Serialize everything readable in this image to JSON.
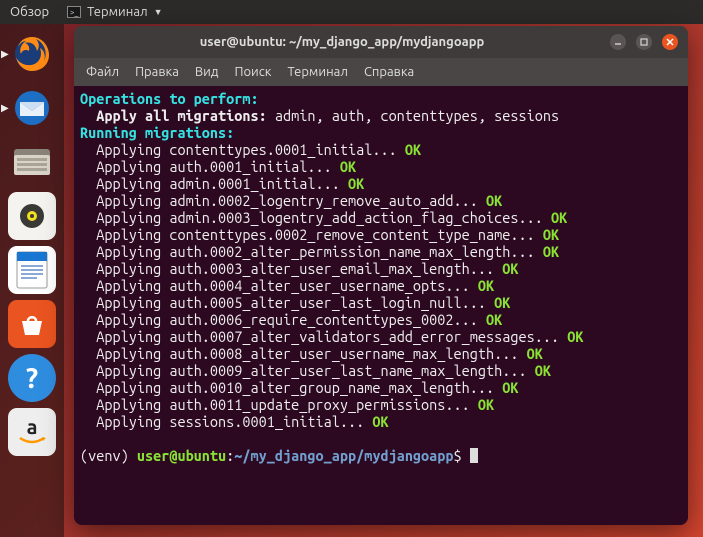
{
  "top_panel": {
    "overview": "Обзор",
    "terminal": "Терминал"
  },
  "launcher": {
    "items": [
      {
        "name": "firefox"
      },
      {
        "name": "thunderbird"
      },
      {
        "name": "files"
      },
      {
        "name": "rhythmbox"
      },
      {
        "name": "writer"
      },
      {
        "name": "software"
      },
      {
        "name": "help"
      },
      {
        "name": "amazon"
      }
    ]
  },
  "window": {
    "title": "user@ubuntu: ~/my_django_app/mydjangoapp",
    "menu": {
      "file": "Файл",
      "edit": "Правка",
      "view": "Вид",
      "search": "Поиск",
      "terminal": "Терминал",
      "help": "Справка"
    }
  },
  "terminal": {
    "operations_label": "Operations to perform:",
    "apply_label": "  Apply all migrations:",
    "apply_targets": " admin, auth, contenttypes, sessions",
    "running_label": "Running migrations:",
    "migrations": [
      "contenttypes.0001_initial",
      "auth.0001_initial",
      "admin.0001_initial",
      "admin.0002_logentry_remove_auto_add",
      "admin.0003_logentry_add_action_flag_choices",
      "contenttypes.0002_remove_content_type_name",
      "auth.0002_alter_permission_name_max_length",
      "auth.0003_alter_user_email_max_length",
      "auth.0004_alter_user_username_opts",
      "auth.0005_alter_user_last_login_null",
      "auth.0006_require_contenttypes_0002",
      "auth.0007_alter_validators_add_error_messages",
      "auth.0008_alter_user_username_max_length",
      "auth.0009_alter_user_last_name_max_length",
      "auth.0010_alter_group_name_max_length",
      "auth.0011_update_proxy_permissions",
      "sessions.0001_initial"
    ],
    "applying_word": "Applying",
    "ok": "OK",
    "prompt": {
      "venv": "(venv) ",
      "user": "user@ubuntu",
      "colon": ":",
      "path": "~/my_django_app/mydjangoapp",
      "dollar": "$ "
    }
  }
}
